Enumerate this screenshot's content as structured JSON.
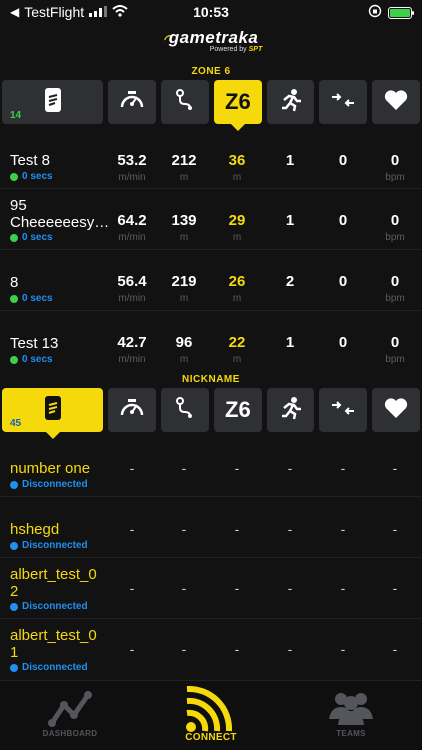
{
  "status_bar": {
    "back_app": "TestFlight",
    "time": "10:53"
  },
  "logo": {
    "name": "gametraka",
    "powered_by": "Powered by",
    "brand": "SPT"
  },
  "zone_section": {
    "label": "ZONE 6",
    "first_tab_count": "14",
    "z6_label": "Z6",
    "active_tab": "zone6",
    "rows": [
      {
        "name": "Test 8",
        "status": "0 secs",
        "speed": "53.2",
        "distance": "212",
        "zone": "36",
        "c5": "1",
        "c6": "0",
        "hr": "0"
      },
      {
        "name": "95 Cheeeeeesy…",
        "status": "0 secs",
        "speed": "64.2",
        "distance": "139",
        "zone": "29",
        "c5": "1",
        "c6": "0",
        "hr": "0"
      },
      {
        "name": "8",
        "status": "0 secs",
        "speed": "56.4",
        "distance": "219",
        "zone": "26",
        "c5": "2",
        "c6": "0",
        "hr": "0"
      },
      {
        "name": "Test 13",
        "status": "0 secs",
        "speed": "42.7",
        "distance": "96",
        "zone": "22",
        "c5": "1",
        "c6": "0",
        "hr": "0"
      }
    ],
    "units": {
      "speed": "m/min",
      "distance": "m",
      "zone": "m",
      "hr": "bpm"
    }
  },
  "nickname_section": {
    "label": "NICKNAME",
    "first_tab_count": "45",
    "z6_label": "Z6",
    "active_tab": "nickname",
    "rows": [
      {
        "name_line1": "number one",
        "name_line2": "",
        "status": "Disconnected"
      },
      {
        "name_line1": "hshegd",
        "name_line2": "",
        "status": "Disconnected"
      },
      {
        "name_line1": "albert_test_0",
        "name_line2": "2",
        "status": "Disconnected"
      },
      {
        "name_line1": "albert_test_0",
        "name_line2": "1",
        "status": "Disconnected"
      }
    ],
    "dash": "-"
  },
  "bottom_nav": [
    {
      "label": "DASHBOARD",
      "icon": "dashboard-chart-icon",
      "active": false
    },
    {
      "label": "CONNECT",
      "icon": "connect-signal-icon",
      "active": true
    },
    {
      "label": "TEAMS",
      "icon": "teams-people-icon",
      "active": false
    }
  ],
  "colors": {
    "accent": "#f5d90a",
    "connected": "#3ecf4a",
    "link": "#1f8ff0",
    "background": "#121212",
    "tile": "#2f3033"
  }
}
